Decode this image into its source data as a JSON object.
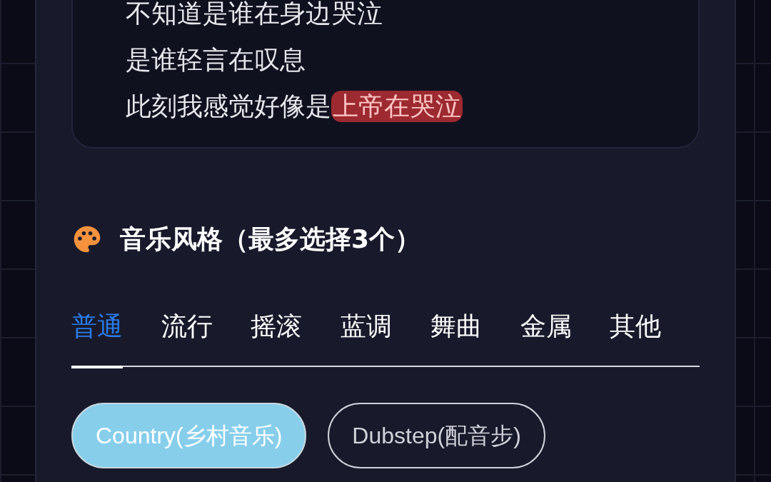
{
  "lyrics": [
    {
      "text": "不知道是谁在身边哭泣"
    },
    {
      "text": "是谁轻言在叹息"
    },
    {
      "text": "此刻我感觉好像是",
      "marked": "上帝在哭泣"
    }
  ],
  "section": {
    "title": "音乐风格（最多选择3个）"
  },
  "tabs": [
    {
      "label": "普通",
      "selected": true
    },
    {
      "label": "流行",
      "selected": false
    },
    {
      "label": "摇滚",
      "selected": false
    },
    {
      "label": "蓝调",
      "selected": false
    },
    {
      "label": "舞曲",
      "selected": false
    },
    {
      "label": "金属",
      "selected": false
    },
    {
      "label": "其他",
      "selected": false
    }
  ],
  "styles": [
    {
      "label": "Country(乡村音乐)",
      "selected": true
    },
    {
      "label": "Dubstep(配音步)",
      "selected": false
    }
  ]
}
